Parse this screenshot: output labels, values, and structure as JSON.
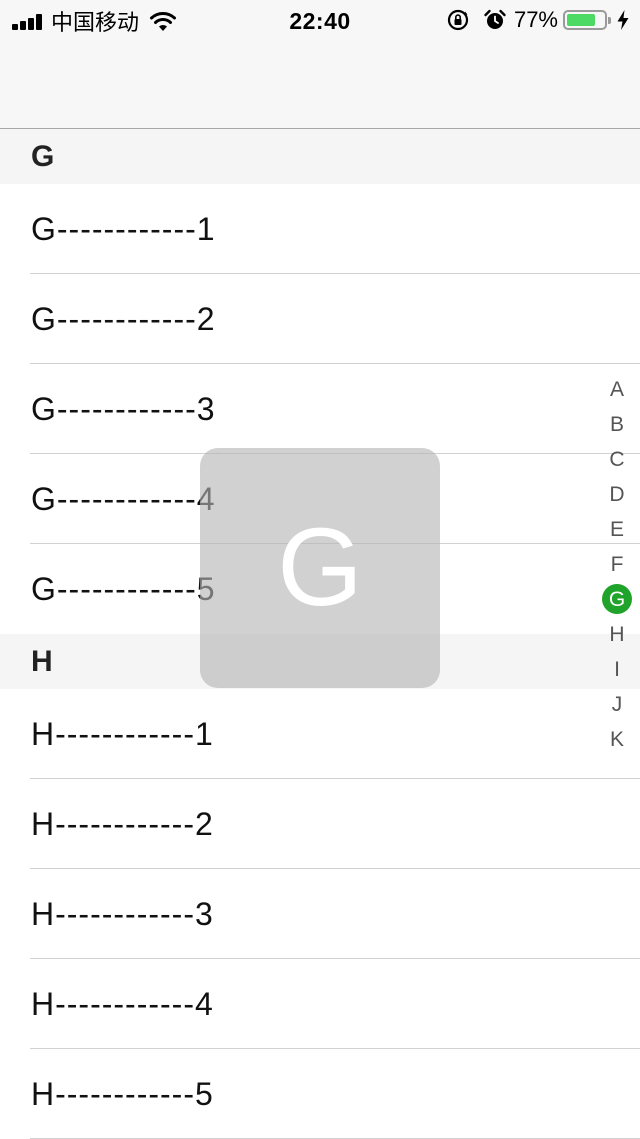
{
  "status_bar": {
    "carrier": "中国移动",
    "time": "22:40",
    "battery_percent": "77%",
    "battery_level": 0.77,
    "battery_color": "#4cd964",
    "icons": [
      "signal-icon",
      "wifi-icon",
      "orientation-lock-icon",
      "alarm-icon",
      "battery-icon",
      "charging-icon"
    ]
  },
  "sections": [
    {
      "header": "G",
      "rows": [
        "G------------1",
        "G------------2",
        "G------------3",
        "G------------4",
        "G------------5"
      ]
    },
    {
      "header": "H",
      "rows": [
        "H------------1",
        "H------------2",
        "H------------3",
        "H------------4",
        "H------------5"
      ]
    }
  ],
  "index_bar": {
    "letters": [
      "A",
      "B",
      "C",
      "D",
      "E",
      "F",
      "G",
      "H",
      "I",
      "J",
      "K"
    ],
    "selected": "G",
    "selected_color": "#1fa32a"
  },
  "overlay": {
    "letter": "G"
  }
}
